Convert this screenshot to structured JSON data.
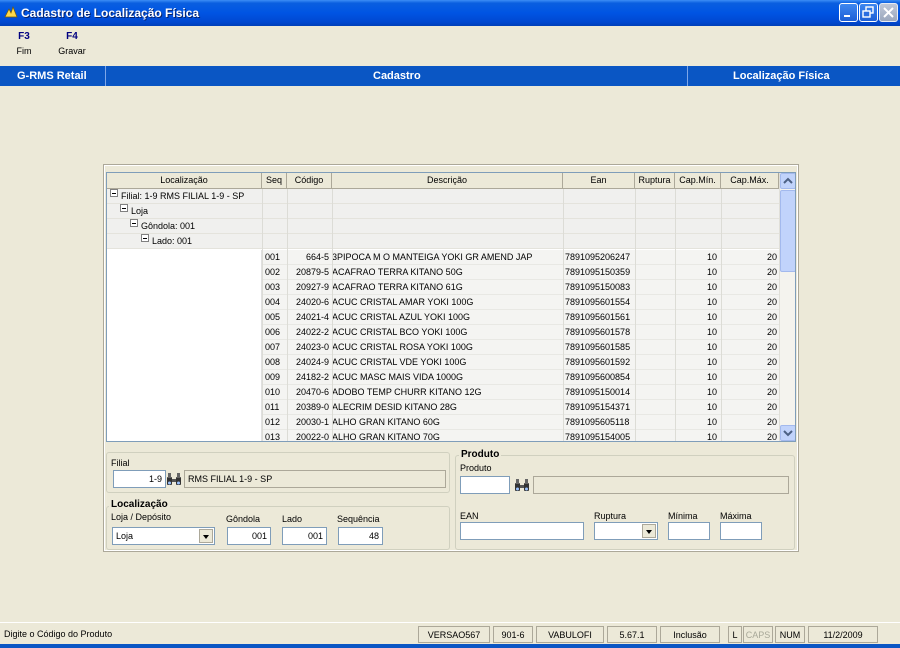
{
  "window": {
    "title": "Cadastro de Localização Física"
  },
  "toolbar": {
    "keys": [
      {
        "key": "F3",
        "label": "Fim"
      },
      {
        "key": "F4",
        "label": "Gravar"
      }
    ]
  },
  "header": {
    "left": "G-RMS Retail",
    "center": "Cadastro",
    "right": "Localização Física"
  },
  "grid": {
    "columns": [
      "Localização",
      "Seq",
      "Código",
      "Descrição",
      "Ean",
      "Ruptura",
      "Cap.Mín.",
      "Cap.Máx."
    ],
    "tree": [
      "Filial: 1-9  RMS FILIAL 1-9 - SP",
      "Loja",
      "Gôndola: 001",
      "Lado: 001"
    ],
    "rows": [
      {
        "seq": "001",
        "codigo": "664-5",
        "descricao": "3PIPOCA M O MANTEIGA YOKI GR AMEND JAP",
        "ean": "7891095206247",
        "ruptura": "",
        "min": "10",
        "max": "20"
      },
      {
        "seq": "002",
        "codigo": "20879-5",
        "descricao": "ACAFRAO TERRA KITANO 50G",
        "ean": "7891095150359",
        "ruptura": "",
        "min": "10",
        "max": "20"
      },
      {
        "seq": "003",
        "codigo": "20927-9",
        "descricao": "ACAFRAO TERRA KITANO 61G",
        "ean": "7891095150083",
        "ruptura": "",
        "min": "10",
        "max": "20"
      },
      {
        "seq": "004",
        "codigo": "24020-6",
        "descricao": "ACUC CRISTAL AMAR YOKI 100G",
        "ean": "7891095601554",
        "ruptura": "",
        "min": "10",
        "max": "20"
      },
      {
        "seq": "005",
        "codigo": "24021-4",
        "descricao": "ACUC CRISTAL AZUL YOKI 100G",
        "ean": "7891095601561",
        "ruptura": "",
        "min": "10",
        "max": "20"
      },
      {
        "seq": "006",
        "codigo": "24022-2",
        "descricao": "ACUC CRISTAL BCO YOKI 100G",
        "ean": "7891095601578",
        "ruptura": "",
        "min": "10",
        "max": "20"
      },
      {
        "seq": "007",
        "codigo": "24023-0",
        "descricao": "ACUC CRISTAL ROSA YOKI 100G",
        "ean": "7891095601585",
        "ruptura": "",
        "min": "10",
        "max": "20"
      },
      {
        "seq": "008",
        "codigo": "24024-9",
        "descricao": "ACUC CRISTAL VDE YOKI 100G",
        "ean": "7891095601592",
        "ruptura": "",
        "min": "10",
        "max": "20"
      },
      {
        "seq": "009",
        "codigo": "24182-2",
        "descricao": "ACUC MASC MAIS VIDA 1000G",
        "ean": "7891095600854",
        "ruptura": "",
        "min": "10",
        "max": "20"
      },
      {
        "seq": "010",
        "codigo": "20470-6",
        "descricao": "ADOBO TEMP CHURR KITANO 12G",
        "ean": "7891095150014",
        "ruptura": "",
        "min": "10",
        "max": "20"
      },
      {
        "seq": "011",
        "codigo": "20389-0",
        "descricao": "ALECRIM DESID KITANO 28G",
        "ean": "7891095154371",
        "ruptura": "",
        "min": "10",
        "max": "20"
      },
      {
        "seq": "012",
        "codigo": "20030-1",
        "descricao": "ALHO GRAN KITANO 60G",
        "ean": "7891095605118",
        "ruptura": "",
        "min": "10",
        "max": "20"
      },
      {
        "seq": "013",
        "codigo": "20022-0",
        "descricao": "ALHO GRAN KITANO 70G",
        "ean": "7891095154005",
        "ruptura": "",
        "min": "10",
        "max": "20"
      }
    ]
  },
  "filial": {
    "label": "Filial",
    "code": "1-9",
    "name": "RMS FILIAL 1-9 - SP"
  },
  "localizacao": {
    "title": "Localização",
    "loja_label": "Loja / Depósito",
    "loja_value": "Loja",
    "gondola_label": "Gôndola",
    "gondola_value": "001",
    "lado_label": "Lado",
    "lado_value": "001",
    "sequencia_label": "Sequência",
    "sequencia_value": "48"
  },
  "produto": {
    "title": "Produto",
    "produto_label": "Produto",
    "produto_value": "",
    "produto_desc": "",
    "ean_label": "EAN",
    "ean_value": "",
    "ruptura_label": "Ruptura",
    "ruptura_value": "",
    "minima_label": "Mínima",
    "minima_value": "",
    "maxima_label": "Máxima",
    "maxima_value": ""
  },
  "statusbar": {
    "message": "Digite o Código do Produto",
    "version": "VERSAO567",
    "code": "901-6",
    "user": "VABULOFI",
    "build": "5.67.1",
    "mode": "Inclusão",
    "l": "L",
    "caps": "CAPS",
    "num": "NUM",
    "date": "11/2/2009"
  },
  "colors": {
    "header_blue": "#0a56c4",
    "titlebar_blue": "#0054e3",
    "key_blue": "#000080"
  },
  "icons": [
    "app-icon",
    "minimize-icon",
    "maximize-icon",
    "close-icon",
    "binoculars-icon",
    "scroll-up-icon",
    "scroll-down-icon",
    "dropdown-arrow-icon",
    "tree-collapse-icon"
  ]
}
